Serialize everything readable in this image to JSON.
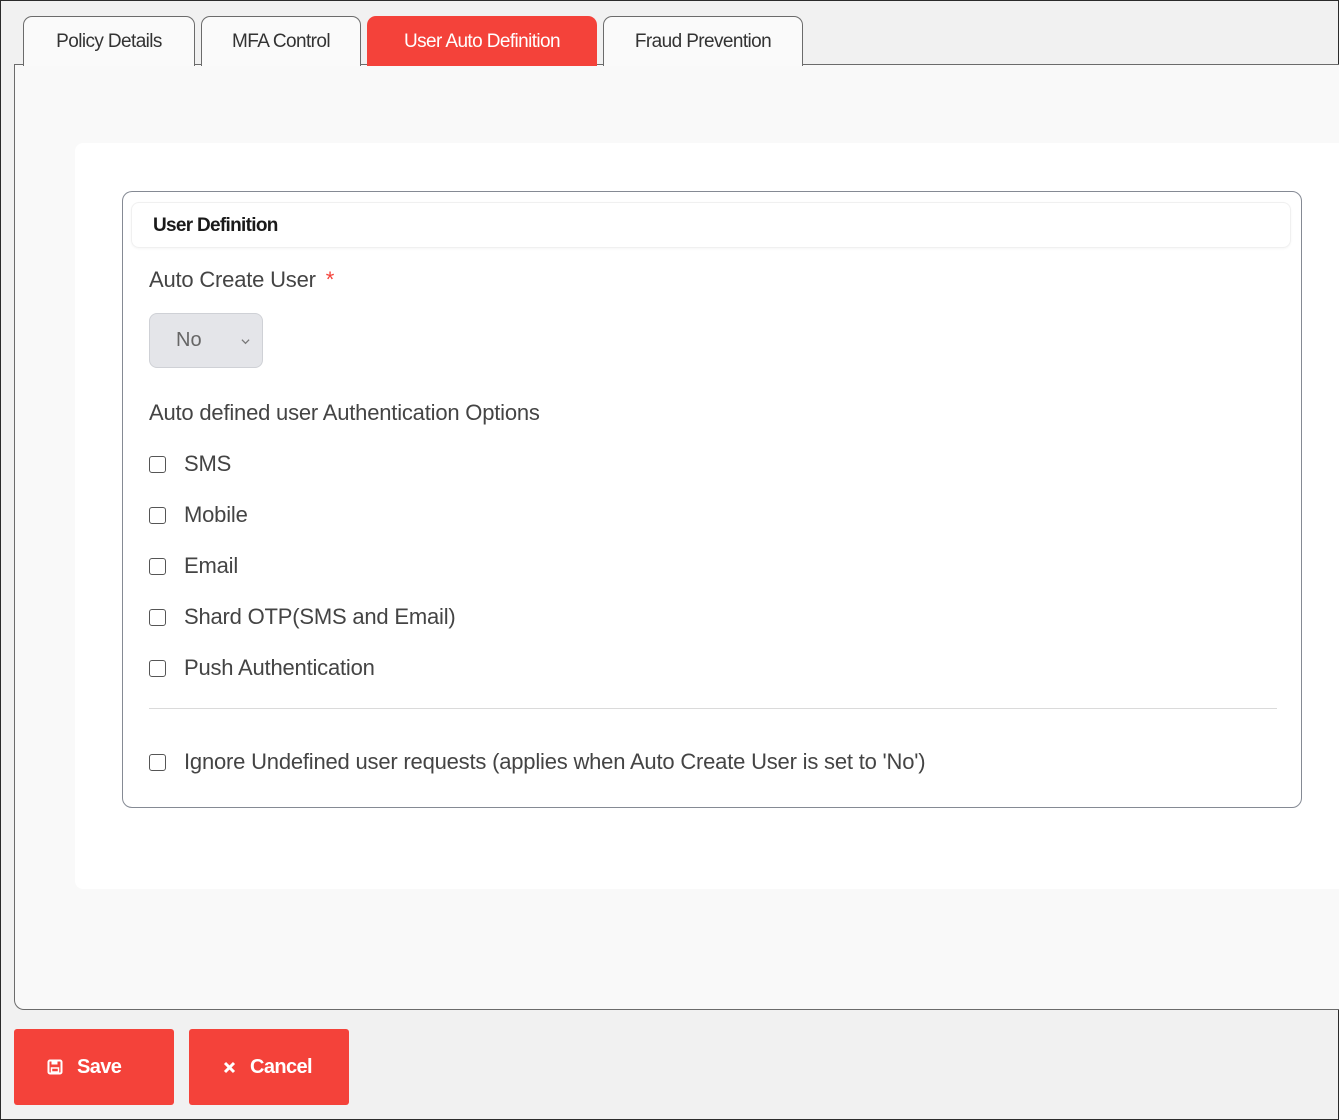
{
  "tabs": [
    {
      "label": "Policy Details",
      "active": false
    },
    {
      "label": "MFA Control",
      "active": false
    },
    {
      "label": "User Auto Definition",
      "active": true
    },
    {
      "label": "Fraud Prevention",
      "active": false
    }
  ],
  "user_definition": {
    "section_title": "User Definition",
    "auto_create_user": {
      "label": "Auto Create User",
      "required_marker": "*",
      "selected_value": "No"
    },
    "auth_options_label": "Auto defined user Authentication Options",
    "auth_options": [
      {
        "label": "SMS",
        "checked": false
      },
      {
        "label": "Mobile",
        "checked": false
      },
      {
        "label": "Email",
        "checked": false
      },
      {
        "label": "Shard OTP(SMS and Email)",
        "checked": false
      },
      {
        "label": "Push Authentication",
        "checked": false
      }
    ],
    "ignore_undefined": {
      "label": "Ignore Undefined user requests (applies when Auto Create User is set to 'No')",
      "checked": false
    }
  },
  "actions": {
    "save_label": "Save",
    "cancel_label": "Cancel"
  },
  "colors": {
    "accent": "#f4423a",
    "required": "#f4423a"
  },
  "icons": {
    "save": "floppy-disk-icon",
    "cancel": "close-x-icon",
    "select": "chevron-down-icon"
  }
}
